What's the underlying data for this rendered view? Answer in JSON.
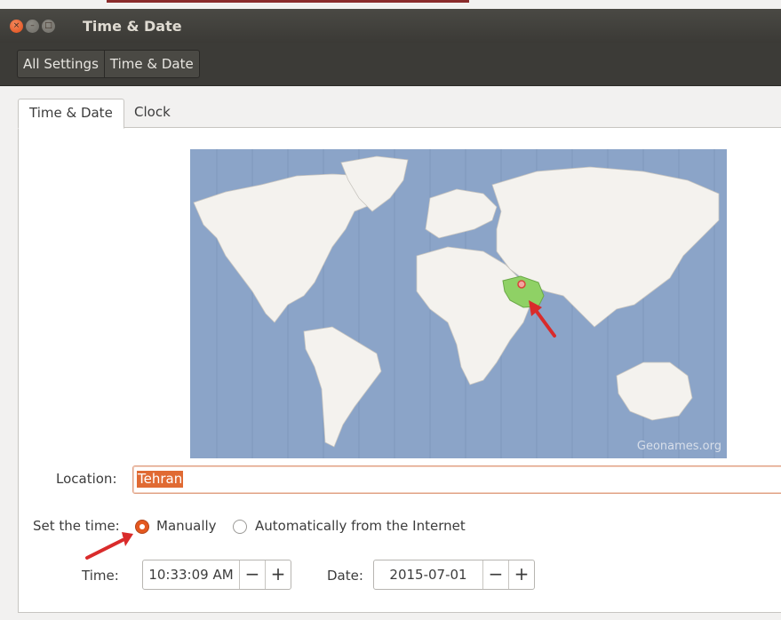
{
  "window": {
    "title": "Time & Date"
  },
  "breadcrumb": [
    "All Settings",
    "Time & Date"
  ],
  "tabs": [
    {
      "label": "Time & Date",
      "active": true
    },
    {
      "label": "Clock",
      "active": false
    }
  ],
  "map": {
    "credit": "Geonames.org",
    "selected_region": "Iran"
  },
  "location": {
    "label": "Location:",
    "value": "Tehran"
  },
  "set_time": {
    "label": "Set the time:",
    "options": [
      {
        "label": "Manually",
        "selected": true
      },
      {
        "label": "Automatically from the Internet",
        "selected": false
      }
    ]
  },
  "time": {
    "label": "Time:",
    "value": "10:33:09 AM",
    "minus": "−",
    "plus": "+"
  },
  "date": {
    "label": "Date:",
    "value": "2015-07-01",
    "minus": "−",
    "plus": "+"
  },
  "colors": {
    "accent": "#e4581f",
    "map_water": "#8ba4c8",
    "map_land": "#f4f2ee",
    "highlight": "#8fd165"
  },
  "icons": {
    "close": "close-icon",
    "minimize": "minimize-icon",
    "maximize": "maximize-icon"
  }
}
